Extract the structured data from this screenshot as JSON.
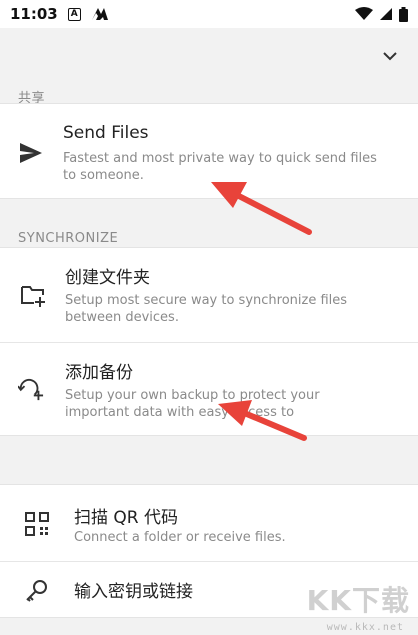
{
  "status_bar": {
    "time": "11:03",
    "icons": [
      "a-notification-icon",
      "app-logo-icon",
      "wifi-icon",
      "signal-icon",
      "battery-icon"
    ]
  },
  "top_bar": {
    "menu_icon": "chevron-down-icon"
  },
  "share_section": {
    "header": "共享",
    "items": [
      {
        "title": "Send Files",
        "description": "Fastest and most private way to quick send files to someone.",
        "icon": "send-icon"
      }
    ]
  },
  "sync_section": {
    "header": "SYNCHRONIZE",
    "items": [
      {
        "title": "创建文件夹",
        "description": "Setup most secure way to synchronize files between devices.",
        "icon": "folder-add-icon"
      },
      {
        "title": "添加备份",
        "description": "Setup your own backup to protect your important data with easy access to",
        "icon": "backup-icon"
      }
    ]
  },
  "bottom_section": {
    "items": [
      {
        "title": "扫描 QR 代码",
        "description": "Connect a folder or receive files.",
        "icon": "qr-code-icon"
      },
      {
        "title": "输入密钥或链接",
        "icon": "key-icon"
      }
    ]
  },
  "watermark": {
    "logo": "KK下载",
    "url": "www.kkx.net"
  },
  "colors": {
    "annotation_arrow": "#e8433a",
    "accent_text": "#222222",
    "secondary_text": "#8a8a8a"
  }
}
